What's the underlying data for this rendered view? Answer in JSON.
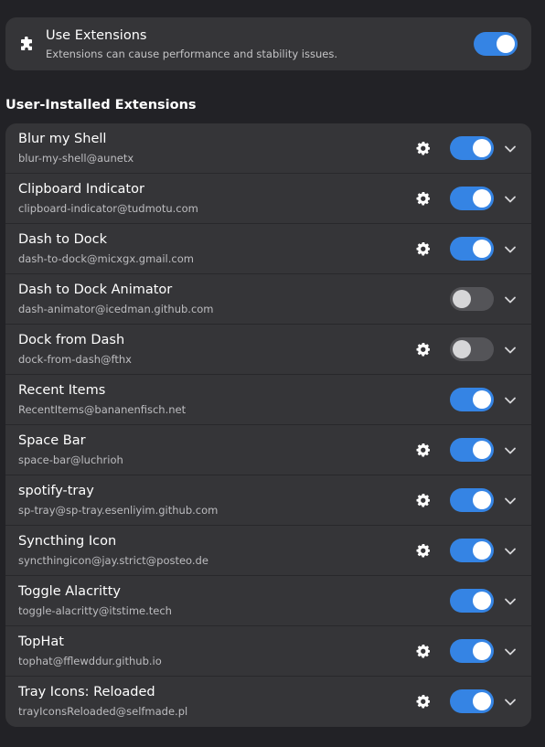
{
  "use_extensions": {
    "title": "Use Extensions",
    "subtitle": "Extensions can cause performance and stability issues.",
    "enabled": true,
    "icon": "puzzle-icon"
  },
  "section_title": "User-Installed Extensions",
  "colors": {
    "accent": "#3584e4",
    "background": "#222226",
    "card": "#353538",
    "switch_off": "#545458"
  },
  "extensions": [
    {
      "name": "Blur my Shell",
      "uuid": "blur-my-shell@aunetx",
      "has_settings": true,
      "enabled": true
    },
    {
      "name": "Clipboard Indicator",
      "uuid": "clipboard-indicator@tudmotu.com",
      "has_settings": true,
      "enabled": true
    },
    {
      "name": "Dash to Dock",
      "uuid": "dash-to-dock@micxgx.gmail.com",
      "has_settings": true,
      "enabled": true
    },
    {
      "name": "Dash to Dock Animator",
      "uuid": "dash-animator@icedman.github.com",
      "has_settings": false,
      "enabled": false
    },
    {
      "name": "Dock from Dash",
      "uuid": "dock-from-dash@fthx",
      "has_settings": true,
      "enabled": false
    },
    {
      "name": "Recent Items",
      "uuid": "RecentItems@bananenfisch.net",
      "has_settings": false,
      "enabled": true
    },
    {
      "name": "Space Bar",
      "uuid": "space-bar@luchrioh",
      "has_settings": true,
      "enabled": true
    },
    {
      "name": "spotify-tray",
      "uuid": "sp-tray@sp-tray.esenliyim.github.com",
      "has_settings": true,
      "enabled": true
    },
    {
      "name": "Syncthing Icon",
      "uuid": "syncthingicon@jay.strict@posteo.de",
      "has_settings": true,
      "enabled": true
    },
    {
      "name": "Toggle Alacritty",
      "uuid": "toggle-alacritty@itstime.tech",
      "has_settings": false,
      "enabled": true
    },
    {
      "name": "TopHat",
      "uuid": "tophat@fflewddur.github.io",
      "has_settings": true,
      "enabled": true
    },
    {
      "name": "Tray Icons: Reloaded",
      "uuid": "trayIconsReloaded@selfmade.pl",
      "has_settings": true,
      "enabled": true
    }
  ]
}
